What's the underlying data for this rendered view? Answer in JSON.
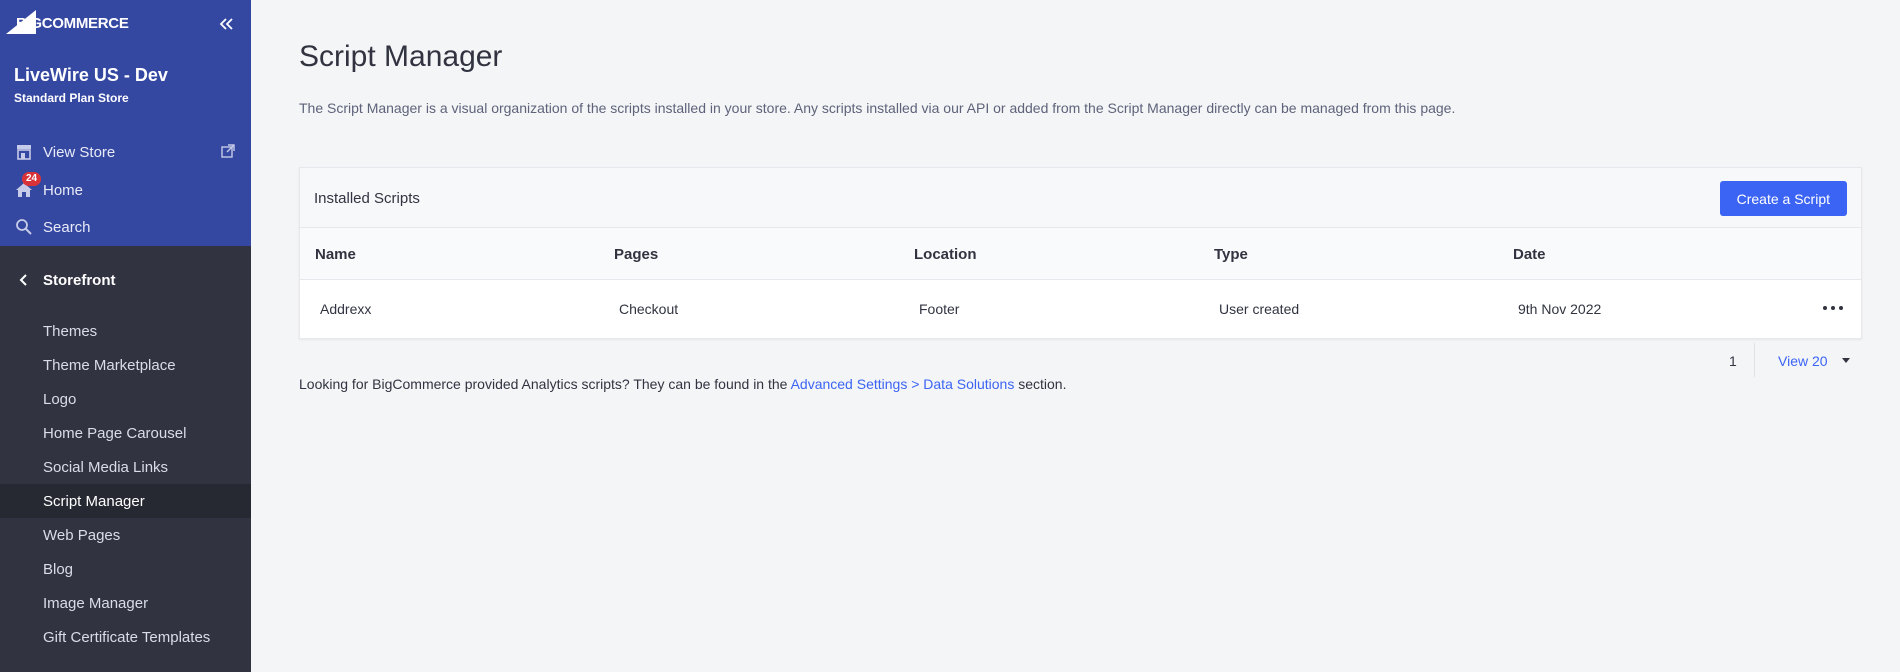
{
  "brand": {
    "logo_text": "BIGCOMMERCE",
    "accent": "#3c64f4",
    "sidebar_top": "#3447a1",
    "sidebar_bg": "#313440"
  },
  "store": {
    "name": "LiveWire US - Dev",
    "plan": "Standard Plan Store"
  },
  "nav_top": {
    "view_store": "View Store",
    "home": "Home",
    "home_badge": "24",
    "search": "Search"
  },
  "storefront": {
    "title": "Storefront",
    "items": [
      {
        "label": "Themes"
      },
      {
        "label": "Theme Marketplace"
      },
      {
        "label": "Logo"
      },
      {
        "label": "Home Page Carousel"
      },
      {
        "label": "Social Media Links"
      },
      {
        "label": "Script Manager"
      },
      {
        "label": "Web Pages"
      },
      {
        "label": "Blog"
      },
      {
        "label": "Image Manager"
      },
      {
        "label": "Gift Certificate Templates"
      }
    ],
    "active": "Script Manager"
  },
  "page": {
    "title": "Script Manager",
    "description": "The Script Manager is a visual organization of the scripts installed in your store. Any scripts installed via our API or added from the Script Manager directly can be managed from this page."
  },
  "card": {
    "title": "Installed Scripts",
    "create_label": "Create a Script",
    "columns": [
      "Name",
      "Pages",
      "Location",
      "Type",
      "Date"
    ],
    "rows": [
      {
        "name": "Addrexx",
        "pages": "Checkout",
        "location": "Footer",
        "type": "User created",
        "date": "9th Nov 2022"
      }
    ]
  },
  "pagination": {
    "page": "1",
    "view": "View 20"
  },
  "footnote": {
    "prefix": "Looking for BigCommerce provided Analytics scripts? They can be found in the ",
    "link": "Advanced Settings > Data Solutions",
    "suffix": " section."
  }
}
